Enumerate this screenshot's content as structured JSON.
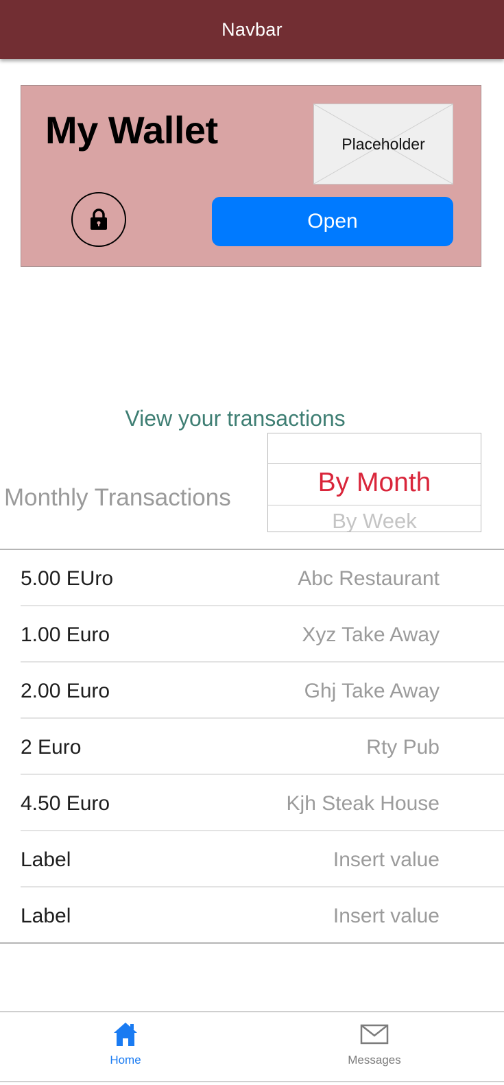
{
  "navbar": {
    "title": "Navbar",
    "background": "#722e33"
  },
  "wallet": {
    "title": "My Wallet",
    "placeholder_label": "Placeholder",
    "lock_icon": "lock-icon",
    "open_label": "Open",
    "card_color": "#d9a4a4",
    "button_color": "#007aff"
  },
  "transactions": {
    "link_text": "View your transactions",
    "heading": "Monthly Transactions",
    "picker": {
      "options": [
        "",
        "By Month",
        "By Week"
      ],
      "selected": "By Month",
      "next": "By Week",
      "selected_color": "#d9253a"
    },
    "rows": [
      {
        "label": "5.00 EUro",
        "value": "Abc Restaurant"
      },
      {
        "label": "1.00 Euro",
        "value": "Xyz Take Away"
      },
      {
        "label": "2.00 Euro",
        "value": "Ghj Take Away"
      },
      {
        "label": "2 Euro",
        "value": "Rty Pub"
      },
      {
        "label": "4.50 Euro",
        "value": "Kjh Steak House"
      },
      {
        "label": "Label",
        "value": "Insert value"
      },
      {
        "label": "Label",
        "value": "Insert value"
      }
    ]
  },
  "tabbar": {
    "tabs": [
      {
        "label": "Home",
        "icon": "home-icon",
        "active": true
      },
      {
        "label": "Messages",
        "icon": "envelope-icon",
        "active": false
      }
    ],
    "active_color": "#1a7bf2"
  }
}
